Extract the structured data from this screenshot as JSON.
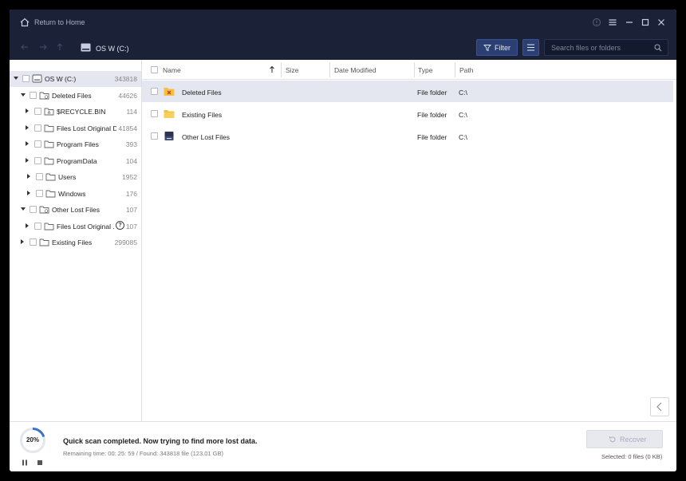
{
  "titlebar": {
    "title": "Return to Home"
  },
  "toolbar": {
    "drive_label": "OS W (C:)",
    "filter_label": "Filter",
    "search_placeholder": "Search files or folders"
  },
  "tree": [
    {
      "label": "OS W (C:)",
      "count": "343818",
      "level": 0,
      "expanded": true,
      "selected": true,
      "icon": "drive-icon"
    },
    {
      "label": "Deleted Files",
      "count": "44626",
      "level": 1,
      "expanded": true,
      "icon": "deleted-folder-icon"
    },
    {
      "label": "$RECYCLE.BIN",
      "count": "114",
      "level": 2,
      "expanded": false,
      "icon": "recycle-folder-icon"
    },
    {
      "label": "Files Lost Original Di...",
      "count": "41854",
      "level": 2,
      "expanded": false,
      "icon": "folder-icon"
    },
    {
      "label": "Program Files",
      "count": "393",
      "level": 2,
      "expanded": false,
      "icon": "folder-icon"
    },
    {
      "label": "ProgramData",
      "count": "104",
      "level": 2,
      "expanded": false,
      "icon": "folder-icon"
    },
    {
      "label": "Users",
      "count": "1952",
      "level": 3,
      "expanded": false,
      "icon": "folder-icon"
    },
    {
      "label": "Windows",
      "count": "176",
      "level": 3,
      "expanded": false,
      "icon": "folder-icon"
    },
    {
      "label": "Other Lost Files",
      "count": "107",
      "level": 1,
      "expanded": true,
      "icon": "lost-folder-icon"
    },
    {
      "label": "Files Lost Original ...",
      "count": "107",
      "level": 2,
      "expanded": false,
      "icon": "folder-icon",
      "help": "?"
    },
    {
      "label": "Existing Files",
      "count": "299085",
      "level": 1,
      "expanded": false,
      "icon": "folder-icon"
    }
  ],
  "list": {
    "columns": {
      "name": "Name",
      "size": "Size",
      "date": "Date Modified",
      "type": "Type",
      "path": "Path"
    },
    "rows": [
      {
        "name": "Deleted Files",
        "type": "File folder",
        "path": "C:\\",
        "icon": "deleted-folder-icon",
        "selected": true
      },
      {
        "name": "Existing Files",
        "type": "File folder",
        "path": "C:\\",
        "icon": "folder-icon"
      },
      {
        "name": "Other Lost Files",
        "type": "File folder",
        "path": "C:\\",
        "icon": "lost-drive-icon"
      }
    ]
  },
  "status": {
    "progress_percent": 20,
    "progress_text": "20%",
    "message": "Quick scan completed. Now trying to find more lost data.",
    "detail": "Remaining time: 00: 25: 59 / Found: 343818 file (123.01 GB)",
    "recover_label": "Recover",
    "selected_info": "Selected: 0 files (0 KB)"
  },
  "colors": {
    "titlebar_bg": "#1b2137",
    "accent": "#2b3f72",
    "folder_yellow": "#f5c040",
    "progress": "#3a6fd8"
  }
}
